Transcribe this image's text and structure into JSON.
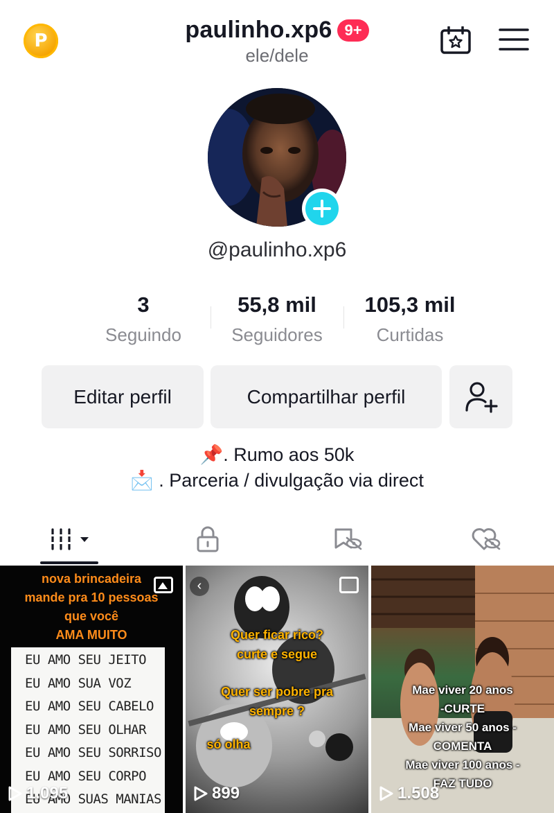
{
  "header": {
    "username": "paulinho.xp6",
    "notification_badge": "9+",
    "pronouns": "ele/dele",
    "coin_letter": "P"
  },
  "profile": {
    "handle": "@paulinho.xp6",
    "stats": [
      {
        "value": "3",
        "label": "Seguindo"
      },
      {
        "value": "55,8 mil",
        "label": "Seguidores"
      },
      {
        "value": "105,3 mil",
        "label": "Curtidas"
      }
    ]
  },
  "buttons": {
    "edit": "Editar perfil",
    "share": "Compartilhar perfil"
  },
  "bio": {
    "line1": "📌. Rumo aos 50k",
    "line2": "📩 . Parceria / divulgação via direct"
  },
  "tabs": [
    "videos-grid",
    "private-lock",
    "reposts",
    "liked"
  ],
  "videos": [
    {
      "views": "1.095",
      "top_text": [
        "nova brincadeira",
        "mande pra 10 pessoas",
        "que você",
        "AMA MUITO"
      ],
      "list_text": [
        "EU AMO SEU JEITO",
        "EU AMO SUA VOZ",
        "EU AMO SEU CABELO",
        "EU AMO SEU OLHAR",
        "EU AMO SEU SORRISO",
        "EU AMO SEU CORPO",
        "EU AMO SUAS MANIAS"
      ]
    },
    {
      "views": "899",
      "text": [
        "Quer ficar rico?",
        "curte e segue",
        "Quer ser pobre pra",
        "sempre ?",
        "só olha"
      ]
    },
    {
      "views": "1.508",
      "text": [
        "Mae viver 20 anos",
        "-CURTE",
        "Mae viver 50 anos -",
        "COMENTA",
        "Mae viver 100 anos -",
        "FAZ TUDO"
      ]
    }
  ],
  "colors": {
    "accent_pink": "#fe2c55",
    "add_cyan": "#20d5ec",
    "button_bg": "#f1f1f2"
  }
}
